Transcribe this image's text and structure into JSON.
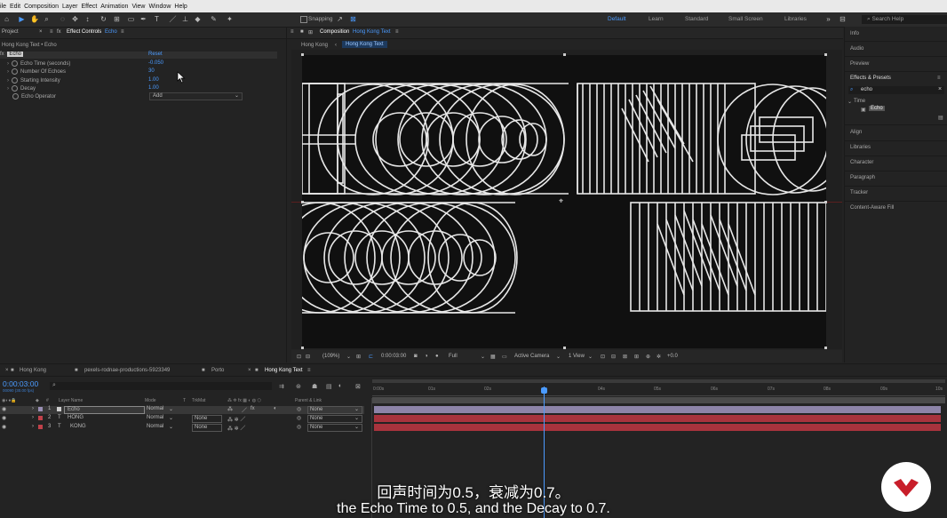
{
  "menubar": {
    "items": [
      "ile",
      "Edit",
      "Composition",
      "Layer",
      "Effect",
      "Animation",
      "View",
      "Window",
      "Help"
    ]
  },
  "toolbar": {
    "snapping_label": "Snapping",
    "workspaces": [
      "Default",
      "Learn",
      "Standard",
      "Small Screen",
      "Libraries"
    ],
    "active_workspace": "Default",
    "search_placeholder": "Search Help"
  },
  "left_panel": {
    "tab_project": "Project",
    "tab_effect_controls": "Effect Controls",
    "tab_effect_target": "Echo",
    "breadcrumb": "Hong Kong Text • Echo",
    "effect": {
      "fx": "fx",
      "name": "Echo",
      "reset": "Reset",
      "params": [
        {
          "label": "Echo Time (seconds)",
          "value": "-0.050"
        },
        {
          "label": "Number Of Echoes",
          "value": "30"
        },
        {
          "label": "Starting Intensity",
          "value": "1.00"
        },
        {
          "label": "Decay",
          "value": "1.00"
        },
        {
          "label": "Echo Operator",
          "value": "Add"
        }
      ]
    }
  },
  "composition_panel": {
    "tab_label": "Composition",
    "tab_target": "Hong Kong Text",
    "breadcrumbs": [
      "Hong Kong",
      "Hong Kong Text"
    ],
    "viewer_bar": {
      "zoom": "(109%)",
      "timecode": "0:00:03:00",
      "resolution": "Full",
      "camera": "Active Camera",
      "views": "1 View",
      "exposure": "+0.0"
    }
  },
  "right_panel": {
    "items_top": [
      "Info",
      "Audio",
      "Preview"
    ],
    "effects_presets": {
      "title": "Effects & Presets",
      "search_value": "echo",
      "category": "Time",
      "result": "Echo"
    },
    "items_bottom": [
      "Align",
      "Libraries",
      "Character",
      "Paragraph",
      "Tracker",
      "Content-Aware Fill"
    ]
  },
  "timeline": {
    "tabs": [
      "Hong Kong",
      "pexels-rodnae-productions-5923349",
      "Porto",
      "Hong Kong Text"
    ],
    "active_tab": "Hong Kong Text",
    "timecode": "0:00:03:00",
    "timecode_sub": "00090 (30.00 fps)",
    "columns": [
      "#",
      "Layer Name",
      "Mode",
      "T",
      "TrkMat",
      "Parent & Link"
    ],
    "layers": [
      {
        "num": "1",
        "name": "Echo",
        "mode": "Normal",
        "trkmat": "",
        "parent": "None",
        "color": "#9a8fb5"
      },
      {
        "num": "2",
        "name": "HONG",
        "mode": "Normal",
        "trkmat": "None",
        "parent": "None",
        "color": "#c0414a"
      },
      {
        "num": "3",
        "name": "KONG",
        "mode": "Normal",
        "trkmat": "None",
        "parent": "None",
        "color": "#c0414a"
      }
    ],
    "ruler": [
      "0:00s",
      "01s",
      "02s",
      "03s",
      "04s",
      "05s",
      "06s",
      "07s",
      "08s",
      "09s",
      "10s"
    ]
  },
  "subtitles": {
    "zh": "回声时间为0.5，衰减为0.7。",
    "en": "the Echo Time to 0.5, and the Decay to 0.7."
  }
}
